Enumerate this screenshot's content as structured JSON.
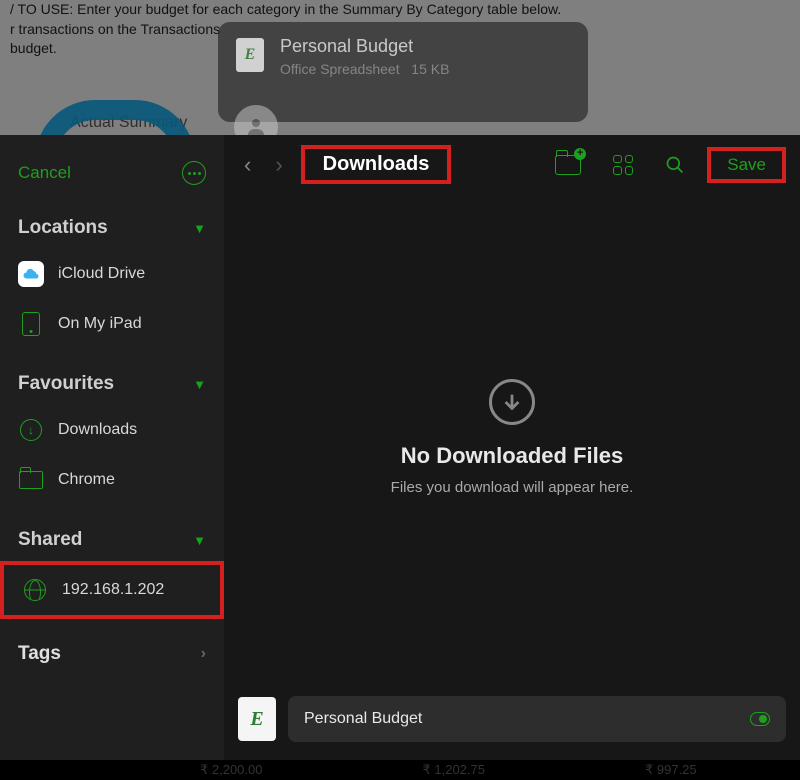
{
  "bg": {
    "text_line1": "/ TO USE: Enter your budget for each category in the Summary By Category table below.",
    "text_line2": "r transactions on the Transactions",
    "text_line3": "budget.",
    "summary_title": "Actual Summary"
  },
  "file_header": {
    "title": "Personal Budget",
    "type": "Office Spreadsheet",
    "size": "15 KB",
    "icon_letter": "E"
  },
  "sidebar": {
    "cancel": "Cancel",
    "sections": {
      "locations": "Locations",
      "favourites": "Favourites",
      "shared": "Shared",
      "tags": "Tags"
    },
    "items": {
      "icloud": "iCloud Drive",
      "ipad": "On My iPad",
      "downloads": "Downloads",
      "chrome": "Chrome",
      "shared_ip": "192.168.1.202"
    }
  },
  "main": {
    "path": "Downloads",
    "save": "Save",
    "empty_title": "No Downloaded Files",
    "empty_sub": "Files you download will appear here.",
    "filename": "Personal Budget",
    "file_icon_letter": "E"
  },
  "bottom": {
    "n1": "₹ 2,200.00",
    "n2": "₹ 1,202.75",
    "n3": "₹ 997.25"
  }
}
